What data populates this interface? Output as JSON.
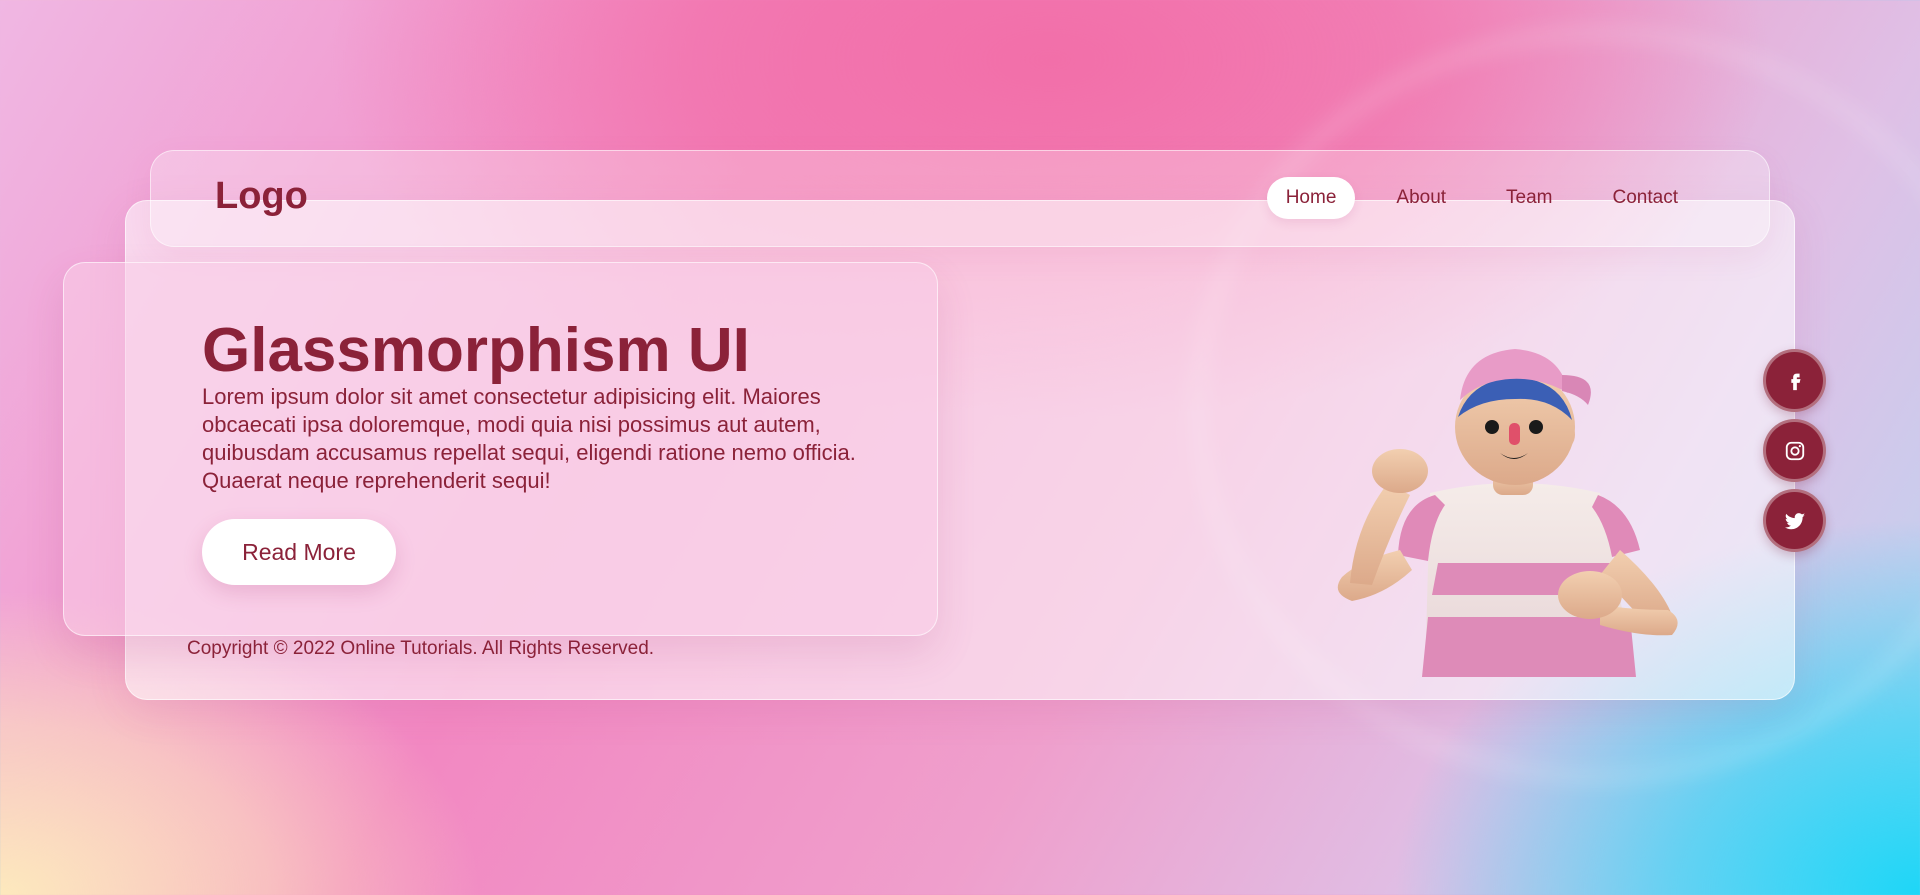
{
  "nav": {
    "logo": "Logo",
    "items": [
      {
        "label": "Home",
        "active": true
      },
      {
        "label": "About",
        "active": false
      },
      {
        "label": "Team",
        "active": false
      },
      {
        "label": "Contact",
        "active": false
      }
    ]
  },
  "hero": {
    "title": "Glassmorphism UI",
    "description": "Lorem ipsum dolor sit amet consectetur adipisicing elit. Maiores obcaecati ipsa doloremque, modi quia nisi possimus aut autem, quibusdam accusamus repellat sequi, eligendi ratione nemo officia. Quaerat neque reprehenderit sequi!",
    "button_label": "Read More"
  },
  "footer": {
    "copyright": "Copyright © 2022 Online Tutorials. All Rights Reserved."
  },
  "social": [
    {
      "icon": "facebook-icon"
    },
    {
      "icon": "instagram-icon"
    },
    {
      "icon": "twitter-icon"
    }
  ],
  "colors": {
    "primary": "#8b2239",
    "white": "#ffffff"
  }
}
